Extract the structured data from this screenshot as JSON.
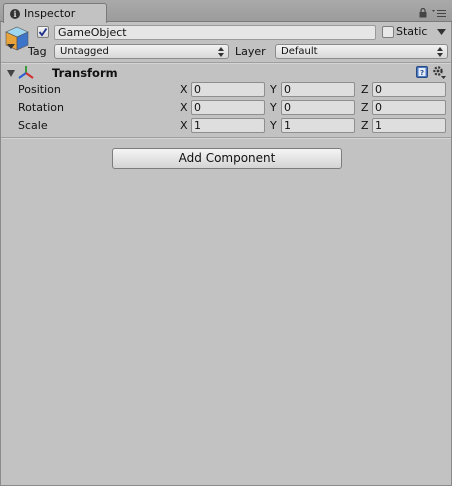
{
  "tab": {
    "title": "Inspector"
  },
  "object": {
    "name": "GameObject",
    "active": true,
    "static_label": "Static",
    "static": false
  },
  "tag": {
    "label": "Tag",
    "value": "Untagged"
  },
  "layer": {
    "label": "Layer",
    "value": "Default"
  },
  "transform": {
    "title": "Transform",
    "rows": [
      {
        "label": "Position",
        "x": "0",
        "y": "0",
        "z": "0"
      },
      {
        "label": "Rotation",
        "x": "0",
        "y": "0",
        "z": "0"
      },
      {
        "label": "Scale",
        "x": "1",
        "y": "1",
        "z": "1"
      }
    ],
    "axes": {
      "x": "X",
      "y": "Y",
      "z": "Z"
    }
  },
  "add_component": {
    "label": "Add Component"
  },
  "icons": {
    "tab": "info-icon",
    "lock": "lock-icon",
    "menu": "menu-icon",
    "object": "gameobject-cube-icon",
    "transform": "transform-axes-icon",
    "help": "help-icon",
    "settings": "gear-icon"
  }
}
